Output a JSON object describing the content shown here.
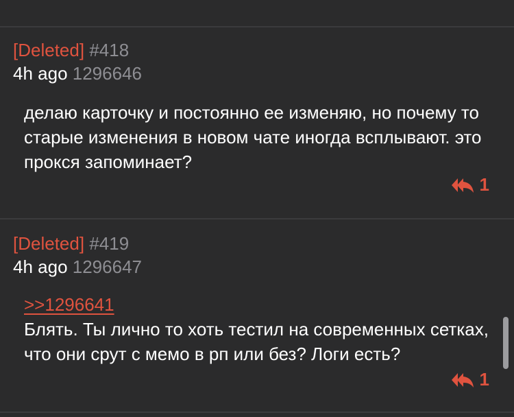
{
  "posts": [
    {
      "author": "[Deleted]",
      "number": "#418",
      "time": "4h ago",
      "id": "1296646",
      "quote": "",
      "text": "делаю карточку и постоянно ее изменяю, но почему то старые изменения в новом чате иногда всплывают. это прокся запоминает?",
      "reply_count": "1"
    },
    {
      "author": "[Deleted]",
      "number": "#419",
      "time": "4h ago",
      "id": "1296647",
      "quote": ">>1296641",
      "text": "Блять. Ты лично то хоть тестил на современных сетках, что они срут с мемо в рп или без? Логи есть?",
      "reply_count": "1"
    }
  ],
  "icons": {
    "reply": "reply-all-icon"
  },
  "colors": {
    "background": "#2b2b2c",
    "accent": "#e0533f",
    "muted": "#8e8e93",
    "text": "#ffffff"
  }
}
